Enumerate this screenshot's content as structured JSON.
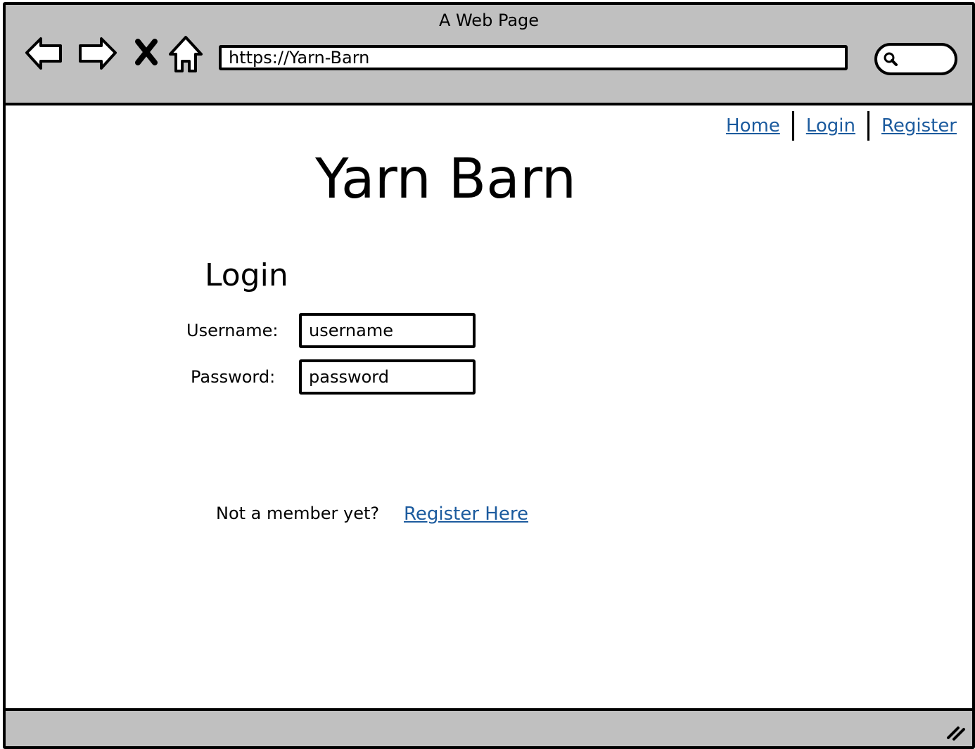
{
  "window": {
    "title": "A Web Page"
  },
  "toolbar": {
    "back_icon": "back-arrow-icon",
    "forward_icon": "forward-arrow-icon",
    "stop_icon": "close-icon",
    "home_icon": "home-icon",
    "url": "https://Yarn-Barn",
    "search_icon": "search-icon"
  },
  "nav": {
    "items": [
      {
        "label": "Home"
      },
      {
        "label": "Login"
      },
      {
        "label": "Register"
      }
    ]
  },
  "page": {
    "site_title": "Yarn Barn",
    "login_heading": "Login"
  },
  "form": {
    "username_label": "Username:",
    "username_value": "username",
    "password_label": "Password:",
    "password_value": "password"
  },
  "footer_prompt": {
    "text": "Not a member yet?",
    "link": "Register Here"
  },
  "colors": {
    "chrome": "#c0c0c0",
    "link": "#1c5b9e"
  }
}
